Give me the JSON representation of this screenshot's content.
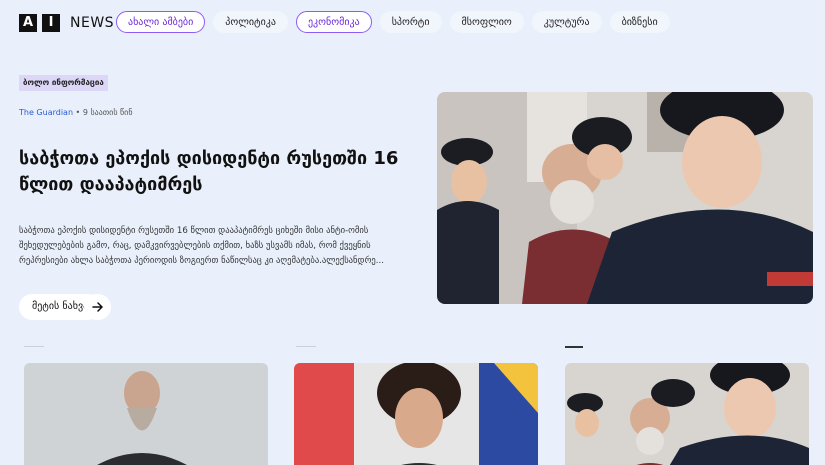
{
  "logo": {
    "letter_a": "A",
    "letter_i": "I",
    "name": "NEWS"
  },
  "nav": {
    "items": [
      {
        "label": "ახალი ამბები",
        "active": true
      },
      {
        "label": "პოლიტიკა",
        "active": false
      },
      {
        "label": "ეკონომიკა",
        "active": true
      },
      {
        "label": "სპორტი",
        "active": false
      },
      {
        "label": "მსოფლიო",
        "active": false
      },
      {
        "label": "კულტურა",
        "active": false
      },
      {
        "label": "ბიზნესი",
        "active": false
      }
    ]
  },
  "hero": {
    "badge": "ბოლო ინფორმაცია",
    "source": "The Guardian",
    "separator": " • ",
    "time": "9 საათის წინ",
    "title": "საბჭოთა ეპოქის დისიდენტი რუსეთში 16 წლით დააპატიმრეს",
    "description": "საბჭოთა ეპოქის დისიდენტი რუსეთში 16 წლით დააპატიმრეს ციხეში მისი ანტი-ომის შეხედულებების გამო, რაც, დამკვირვებლების თქმით, ხაზს უსვამს იმას, რომ ქვეყნის რეპრესიები ახლა საბჭოთა პერიოდის ზოგიერთ ნაწილსაც კი აღემატება.ალექსანდრე...",
    "more_label": "მეტის ნახვა",
    "arrow_icon": "arrow-right-icon"
  },
  "colors": {
    "background": "#e9f0fb",
    "accent": "#8b5cf6",
    "badge_bg": "#dcd6f7",
    "source_link": "#2b5bd7"
  }
}
